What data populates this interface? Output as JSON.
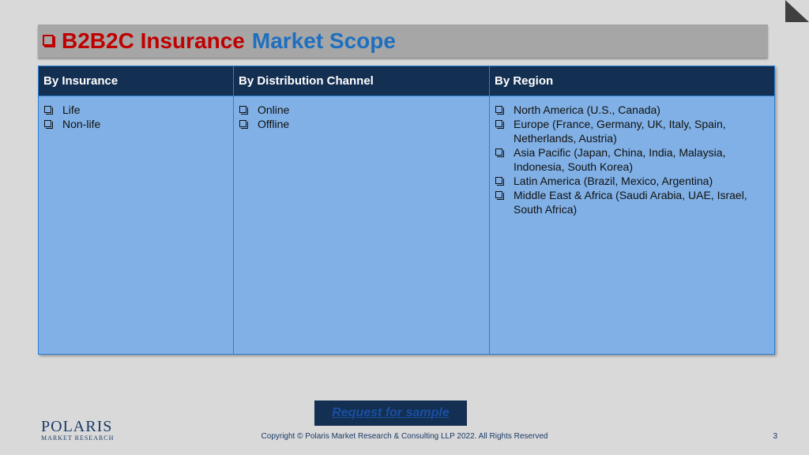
{
  "title": {
    "part1": "B2B2C Insurance",
    "part2": "Market Scope"
  },
  "table": {
    "headers": [
      "By Insurance",
      "By Distribution Channel",
      "By Region"
    ],
    "insurance": [
      "Life",
      "Non-life"
    ],
    "channel": [
      "Online",
      "Offline"
    ],
    "region": [
      "North America (U.S., Canada)",
      "Europe (France, Germany, UK, Italy, Spain, Netherlands, Austria)",
      "Asia Pacific (Japan, China, India, Malaysia, Indonesia, South Korea)",
      "Latin America (Brazil, Mexico, Argentina)",
      "Middle East & Africa (Saudi Arabia, UAE, Israel, South Africa)"
    ]
  },
  "cta": {
    "label": "Request for sample"
  },
  "footer": {
    "logo_name": "POLARIS",
    "logo_sub": "MARKET RESEARCH",
    "copyright": "Copyright © Polaris Market Research & Consulting LLP 2022. All Rights Reserved",
    "page": "3"
  },
  "colors": {
    "title_red": "#c00000",
    "title_blue": "#1f6fbf",
    "header_bg": "#132f52",
    "cell_bg": "#80b0e5"
  }
}
